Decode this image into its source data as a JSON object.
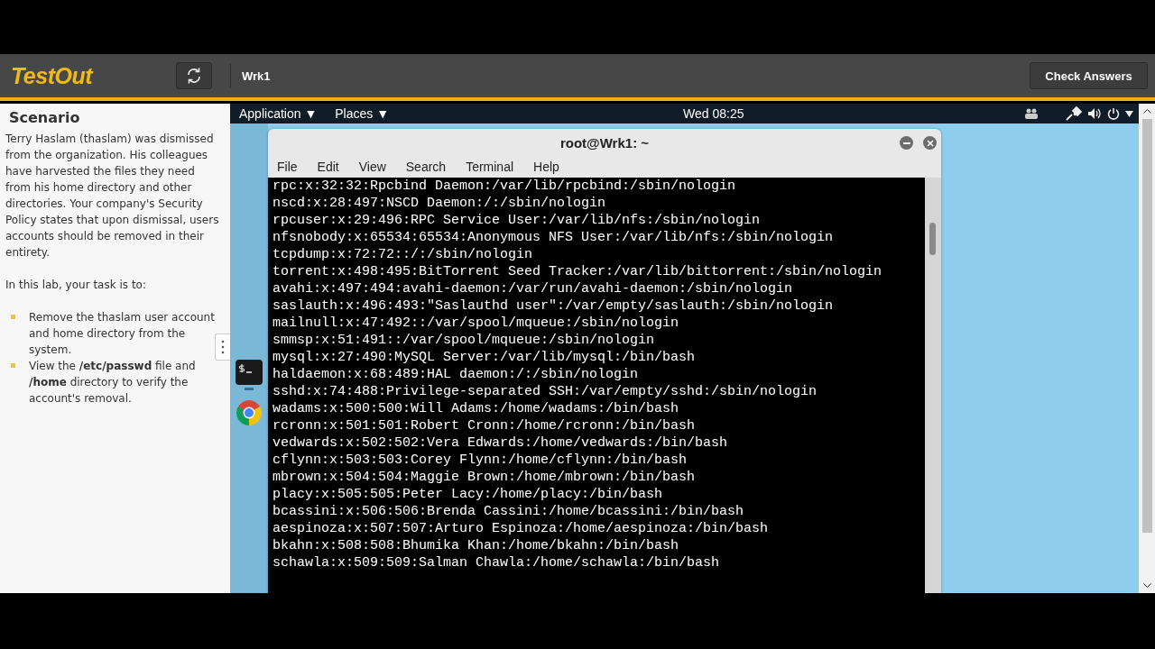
{
  "header": {
    "logo": "TestOut",
    "machine": "Wrk1",
    "check_button": "Check Answers"
  },
  "scenario": {
    "title": "Scenario",
    "description": "Terry Haslam (thaslam) was dismissed from the organization. His colleagues have harvested the files they need from his home directory and other directories. Your company's Security Policy states that upon dismissal, users accounts should be removed in their entirety.",
    "intro": "In this lab, your task is to:",
    "tasks": [
      "Remove the thaslam user account and home directory from the system.",
      "View the **/etc/passwd** file and **/home** directory to verify the account's removal."
    ]
  },
  "desktop": {
    "panel": {
      "menus": [
        "Application ▼",
        "Places ▼"
      ],
      "clock": "Wed 08:25"
    },
    "terminal": {
      "title": "root@Wrk1: ~",
      "menu": [
        "File",
        "Edit",
        "View",
        "Search",
        "Terminal",
        "Help"
      ],
      "lines": [
        "rpc:x:32:32:Rpcbind Daemon:/var/lib/rpcbind:/sbin/nologin",
        "nscd:x:28:497:NSCD Daemon:/:/sbin/nologin",
        "rpcuser:x:29:496:RPC Service User:/var/lib/nfs:/sbin/nologin",
        "nfsnobody:x:65534:65534:Anonymous NFS User:/var/lib/nfs:/sbin/nologin",
        "tcpdump:x:72:72::/:/sbin/nologin",
        "torrent:x:498:495:BitTorrent Seed Tracker:/var/lib/bittorrent:/sbin/nologin",
        "avahi:x:497:494:avahi-daemon:/var/run/avahi-daemon:/sbin/nologin",
        "saslauth:x:496:493:\"Saslauthd user\":/var/empty/saslauth:/sbin/nologin",
        "mailnull:x:47:492::/var/spool/mqueue:/sbin/nologin",
        "smmsp:x:51:491::/var/spool/mqueue:/sbin/nologin",
        "mysql:x:27:490:MySQL Server:/var/lib/mysql:/bin/bash",
        "haldaemon:x:68:489:HAL daemon:/:/sbin/nologin",
        "sshd:x:74:488:Privilege-separated SSH:/var/empty/sshd:/sbin/nologin",
        "wadams:x:500:500:Will Adams:/home/wadams:/bin/bash",
        "rcronn:x:501:501:Robert Cronn:/home/rcronn:/bin/bash",
        "vedwards:x:502:502:Vera Edwards:/home/vedwards:/bin/bash",
        "cflynn:x:503:503:Corey Flynn:/home/cflynn:/bin/bash",
        "mbrown:x:504:504:Maggie Brown:/home/mbrown:/bin/bash",
        "placy:x:505:505:Peter Lacy:/home/placy:/bin/bash",
        "bcassini:x:506:506:Brenda Cassini:/home/bcassini:/bin/bash",
        "aespinoza:x:507:507:Arturo Espinoza:/home/aespinoza:/bin/bash",
        "bkahn:x:508:508:Bhumika Khan:/home/bkahn:/bin/bash",
        "schawla:x:509:509:Salman Chawla:/home/schawla:/bin/bash"
      ]
    }
  }
}
